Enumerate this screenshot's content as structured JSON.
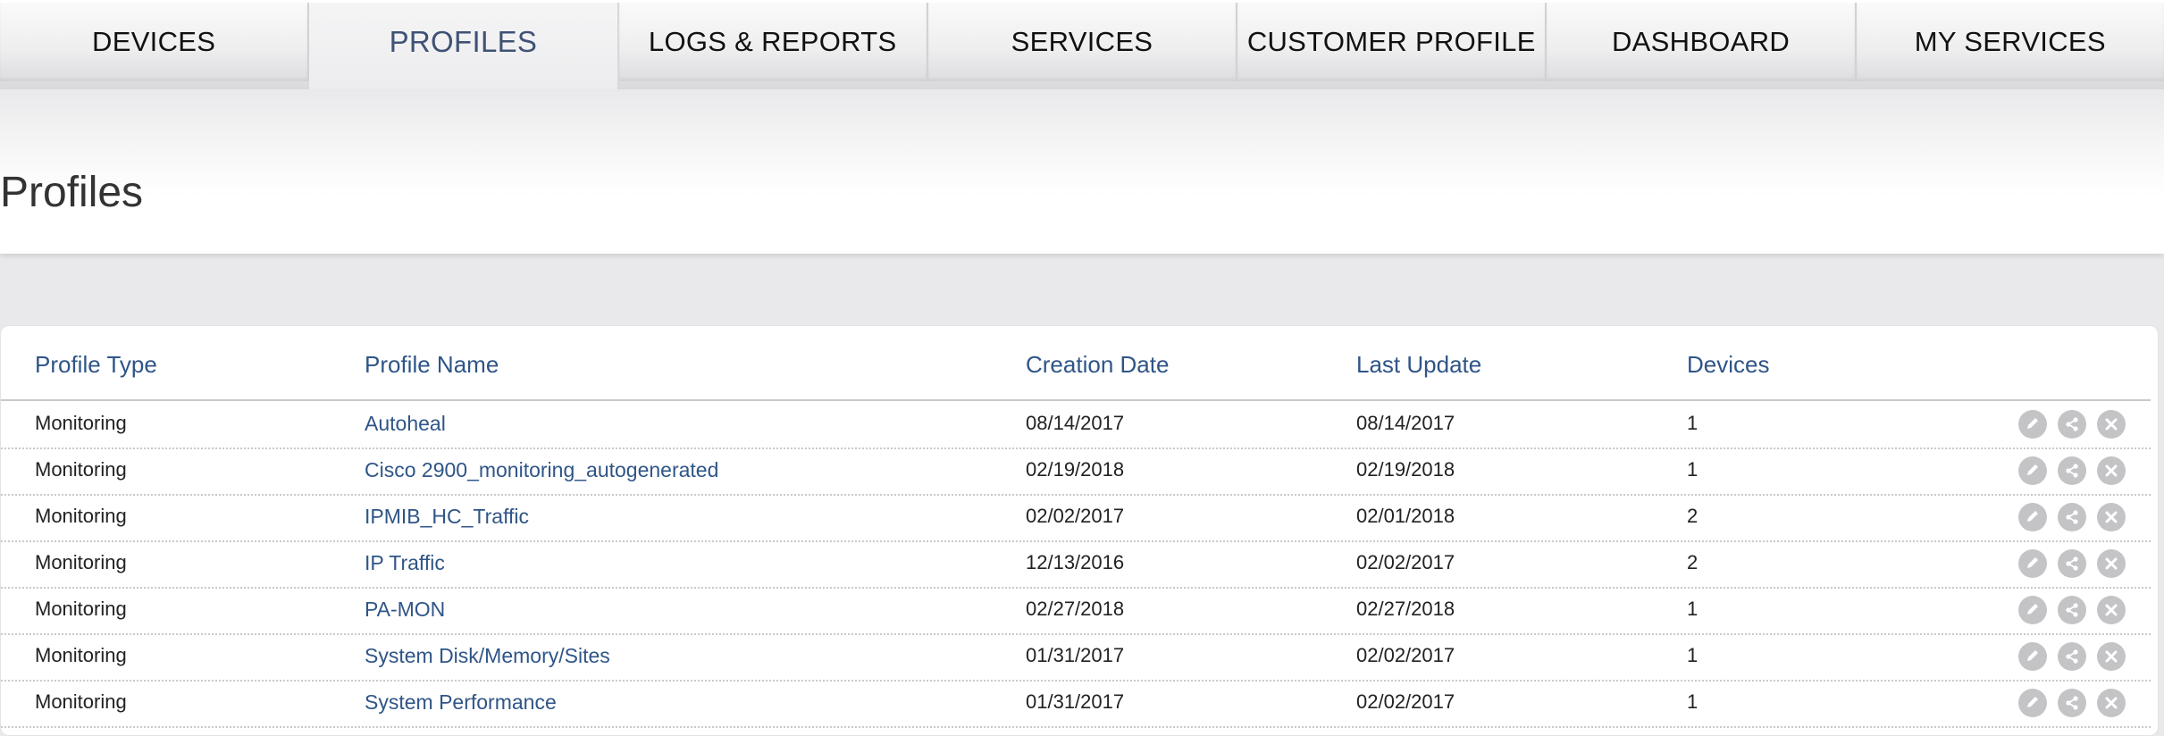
{
  "nav": {
    "tabs": [
      {
        "label": "DEVICES",
        "active": false
      },
      {
        "label": "PROFILES",
        "active": true
      },
      {
        "label": "LOGS & REPORTS",
        "active": false
      },
      {
        "label": "SERVICES",
        "active": false
      },
      {
        "label": "CUSTOMER PROFILE",
        "active": false
      },
      {
        "label": "DASHBOARD",
        "active": false
      },
      {
        "label": "MY SERVICES",
        "active": false
      }
    ]
  },
  "page": {
    "title": "Profiles"
  },
  "table": {
    "columns": [
      "Profile Type",
      "Profile Name",
      "Creation Date",
      "Last Update",
      "Devices"
    ],
    "rows": [
      {
        "type": "Monitoring",
        "name": "Autoheal",
        "created": "08/14/2017",
        "updated": "08/14/2017",
        "devices": "1"
      },
      {
        "type": "Monitoring",
        "name": "Cisco 2900_monitoring_autogenerated",
        "created": "02/19/2018",
        "updated": "02/19/2018",
        "devices": "1"
      },
      {
        "type": "Monitoring",
        "name": "IPMIB_HC_Traffic",
        "created": "02/02/2017",
        "updated": "02/01/2018",
        "devices": "2"
      },
      {
        "type": "Monitoring",
        "name": "IP Traffic",
        "created": "12/13/2016",
        "updated": "02/02/2017",
        "devices": "2"
      },
      {
        "type": "Monitoring",
        "name": "PA-MON",
        "created": "02/27/2018",
        "updated": "02/27/2018",
        "devices": "1"
      },
      {
        "type": "Monitoring",
        "name": "System Disk/Memory/Sites",
        "created": "01/31/2017",
        "updated": "02/02/2017",
        "devices": "1"
      },
      {
        "type": "Monitoring",
        "name": "System Performance",
        "created": "01/31/2017",
        "updated": "02/02/2017",
        "devices": "1"
      }
    ],
    "row_actions": [
      "edit-icon",
      "share-icon",
      "delete-icon"
    ]
  },
  "colors": {
    "accent": "#2f5587",
    "active_tab_text": "#3f5275",
    "action_icon_bg": "#c4c4c7"
  }
}
